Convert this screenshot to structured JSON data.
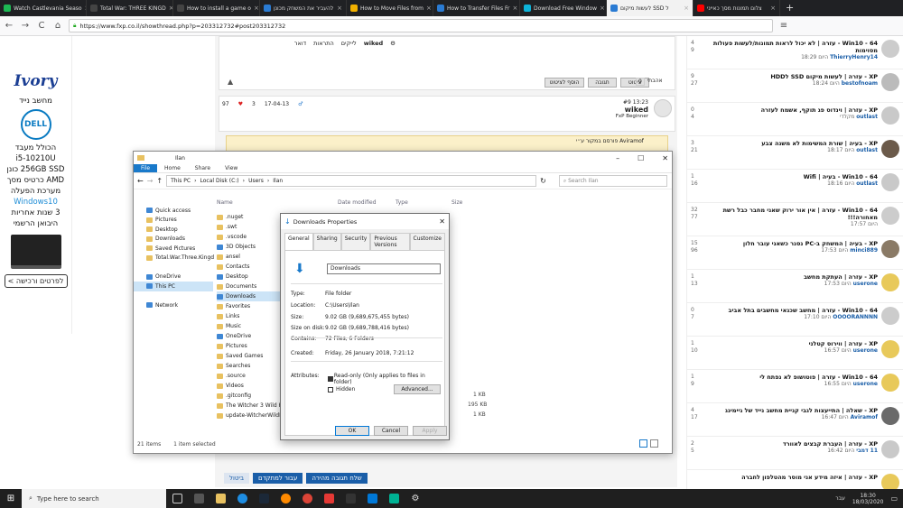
{
  "browser": {
    "tabs": [
      {
        "title": "Watch Castlevania Seaso",
        "color": "#1db954"
      },
      {
        "title": "Total War: THREE KINGD",
        "color": "#444444"
      },
      {
        "title": "How to install a game o",
        "color": "#444444"
      },
      {
        "title": "להעביר את המשחק מכונן",
        "color": "#2a7bd3"
      },
      {
        "title": "How to Move Files from",
        "color": "#f2b100"
      },
      {
        "title": "How to Transfer Files Fr",
        "color": "#2a7bd3"
      },
      {
        "title": "Download Free Window",
        "color": "#0db3d9"
      },
      {
        "title": "לעשות מיקום SSD ל",
        "color": "#2a7bd3",
        "active": true
      },
      {
        "title": "צלום תמונות מסך כאייני",
        "color": "#ff0000"
      }
    ],
    "new_tab": "+",
    "url": "https://www.fxp.co.il/showthread.php?p=203312732#post203312732",
    "back": "←",
    "forward": "→",
    "reload": "C",
    "home": "⌂"
  },
  "ad": {
    "brand": "Ivory",
    "lines": [
      "מחשב נייד",
      "DELL",
      "הכולל מעבד",
      "i5-10210U",
      "256GB SSD כונן",
      "AMD כרטיס מסך",
      "מערכת הפעלה",
      "Windows10",
      "3 שנות אחריות",
      "היבואן הרשמי"
    ],
    "cta": "לפרטים ורכישה >"
  },
  "forum": {
    "post_actions": [
      "דואר",
      "התראות",
      "לייקים",
      "wiked"
    ],
    "buttons": {
      "add_review": "הוסף לציטוט",
      "reply": "תגובה",
      "quote": "ציטוט",
      "likes_count": "0",
      "like": "אהבתי"
    },
    "post_meta": {
      "views": "97",
      "likes": "3",
      "date": "17-04-13",
      "number": "#9",
      "time_label": "היום",
      "time": "13:23",
      "username": "wiked",
      "rank": "FxP Beginner"
    },
    "quote_line": "פורסם במקור ע״י Aviramof",
    "bottom_buttons": {
      "quick_reply": "שלח תגובה מהירה",
      "advanced": "עבור למתקדם",
      "cancel": "ביטול"
    }
  },
  "sidebar": {
    "items": [
      {
        "title": "Win10 - 64 - עזרה | לא יכול לראות תמונות/לעשות פעולות מסוימות",
        "time": "היום 18:29",
        "user": "ThierryHenry14",
        "replies": "4",
        "views": "9",
        "avatar": "#cccccc"
      },
      {
        "title": "XP - עזרה | לעשות מיקום SSD לHDD",
        "time": "היום 18:24",
        "user": "bestofnoam",
        "replies": "9",
        "views": "27",
        "avatar": "#bbbbbb"
      },
      {
        "title": "XP - עזרה | וינדוס פג תוקף, אשמח לעזרה",
        "time": "מקלדי",
        "user": "outlast",
        "replies": "0",
        "views": "4",
        "avatar": "#c9c9c9"
      },
      {
        "title": "XP - בעיה | שורת המשימות לא משנה צבע",
        "time": "היום 18:17",
        "user": "outlast",
        "replies": "3",
        "views": "21",
        "avatar": "#6b5a4a"
      },
      {
        "title": "Win10 - 64 - בעיה | Wifi",
        "time": "היום 18:16",
        "user": "outlast",
        "replies": "1",
        "views": "16",
        "avatar": "#c9c9c9"
      },
      {
        "title": "Win10 - 64 - עזרה | אין אור ירוק שאני מחבר כבל רשת מאחורה!!!",
        "time": "היום 17:57",
        "user": "",
        "replies": "32",
        "views": "77",
        "avatar": "#cccccc"
      },
      {
        "title": "XP - בעיה | המשחק ב-PC נסגר כשאני עובר חלון",
        "time": "היום 17:53",
        "user": "minci889",
        "replies": "15",
        "views": "96",
        "avatar": "#8a7a66"
      },
      {
        "title": "XP - עזרה | העתקת מחשב",
        "time": "היום 17:53",
        "user": "userone",
        "replies": "1",
        "views": "13",
        "avatar": "#e8c95a"
      },
      {
        "title": "Win10 - 64 - עזרה | מחשב שכנאי מחשבים בתל אביב",
        "time": "היום 17:10",
        "user": "OOOORANNNN",
        "replies": "0",
        "views": "7",
        "avatar": "#cccccc"
      },
      {
        "title": "XP - עזרה | ווירוס קטלני",
        "time": "היום 16:57",
        "user": "userone",
        "replies": "1",
        "views": "10",
        "avatar": "#e8c95a"
      },
      {
        "title": "Win10 - 64 - עזרה | פוטושופ לא נפתח לי",
        "time": "היום 16:55",
        "user": "userone",
        "replies": "1",
        "views": "9",
        "avatar": "#e8c95a"
      },
      {
        "title": "XP - שאלה | התייעצות לגבי קניית מחשב נייד של גיימינג",
        "time": "היום 16:47",
        "user": "Aviramof",
        "replies": "4",
        "views": "17",
        "avatar": "#6a6a6a"
      },
      {
        "title": "XP - עזרה | העברת קבצים לאוורד",
        "time": "היום 16:42",
        "user": "11 דמבי",
        "replies": "2",
        "views": "5",
        "avatar": "#c9c9c9"
      },
      {
        "title": "XP - עזרה | איזה מידע אני מוסר מהטלפון לחברה",
        "time": "",
        "user": "",
        "replies": "",
        "views": "",
        "avatar": "#e8c95a"
      }
    ]
  },
  "explorer": {
    "title": "Ilan",
    "ribbon_tabs": [
      "File",
      "Home",
      "Share",
      "View"
    ],
    "breadcrumb": [
      "This PC",
      "Local Disk (C:)",
      "Users",
      "Ilan"
    ],
    "search_placeholder": "Search Ilan",
    "columns": [
      "Name",
      "Date modified",
      "Type",
      "Size"
    ],
    "nav": [
      {
        "label": "Quick access",
        "blue": true
      },
      {
        "label": "Pictures"
      },
      {
        "label": "Desktop"
      },
      {
        "label": "Downloads"
      },
      {
        "label": "Saved Pictures"
      },
      {
        "label": "Total.War.Three.Kingd"
      },
      {
        "label": ""
      },
      {
        "label": "OneDrive",
        "blue": true
      },
      {
        "label": "This PC",
        "blue": true,
        "selected": true
      },
      {
        "label": ""
      },
      {
        "label": "Network",
        "blue": true
      }
    ],
    "files": [
      {
        "name": ".nuget"
      },
      {
        "name": ".swt"
      },
      {
        "name": ".vscode"
      },
      {
        "name": "3D Objects",
        "blue": true
      },
      {
        "name": "ansel"
      },
      {
        "name": "Contacts"
      },
      {
        "name": "Desktop",
        "blue": true
      },
      {
        "name": "Documents"
      },
      {
        "name": "Downloads",
        "blue": true,
        "selected": true
      },
      {
        "name": "Favorites"
      },
      {
        "name": "Links"
      },
      {
        "name": "Music"
      },
      {
        "name": "OneDrive",
        "blue": true
      },
      {
        "name": "Pictures"
      },
      {
        "name": "Saved Games"
      },
      {
        "name": "Searches"
      },
      {
        "name": ".source"
      },
      {
        "name": "Videos"
      },
      {
        "name": ".gitconfig"
      },
      {
        "name": "The Witcher 3 Wild Hu"
      },
      {
        "name": "update-WitcherWildH"
      }
    ],
    "sizes": [
      "1 KB",
      "195 KB",
      "1 KB"
    ],
    "status_items": "21 items",
    "status_selected": "1 item selected"
  },
  "dialog": {
    "title": "Downloads Properties",
    "tabs": [
      "General",
      "Sharing",
      "Security",
      "Previous Versions",
      "Customize"
    ],
    "name": "Downloads",
    "rows": [
      {
        "label": "Type:",
        "value": "File folder"
      },
      {
        "label": "Location:",
        "value": "C:\\Users\\Ilan"
      },
      {
        "label": "Size:",
        "value": "9.02 GB (9,689,675,455 bytes)"
      },
      {
        "label": "Size on disk:",
        "value": "9.02 GB (9,689,788,416 bytes)"
      },
      {
        "label": "Contains:",
        "value": "72 Files, 6 Folders"
      },
      {
        "label": "Created:",
        "value": "Friday, 26 January 2018, 7:21:12"
      },
      {
        "label": "Attributes:",
        "value": "Read-only (Only applies to files in folder)"
      }
    ],
    "hidden": "Hidden",
    "advanced": "Advanced...",
    "ok": "OK",
    "cancel": "Cancel",
    "apply": "Apply"
  },
  "taskbar": {
    "search_placeholder": "Type here to search",
    "time": "18:30",
    "date": "18/03/2020",
    "lang": "עבר"
  }
}
